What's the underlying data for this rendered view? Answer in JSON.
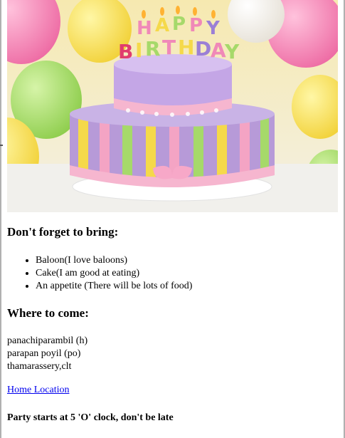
{
  "hero": {
    "image_icon": "birthday-cake-image",
    "letters_top": [
      "H",
      "A",
      "P",
      "P",
      "Y"
    ],
    "letters_bottom": [
      "B",
      "I",
      "R",
      "T",
      "H",
      "D",
      "A",
      "Y"
    ]
  },
  "bring": {
    "heading": "Don't forget to bring:",
    "items": [
      "Baloon(I love baloons)",
      "Cake(I am good at eating)",
      "An appetite (There will be lots of food)"
    ]
  },
  "where": {
    "heading": "Where to come:",
    "address": [
      "panachiparambil (h)",
      "parapan poyil (po)",
      "thamarassery,clt"
    ],
    "link_label": "Home Location"
  },
  "party_note": "Party starts at 5 'O' clock, don't be late",
  "colors": {
    "link": "#0000ee",
    "cake_purple": "#b79ad8",
    "cake_pink": "#f4a4c4"
  }
}
